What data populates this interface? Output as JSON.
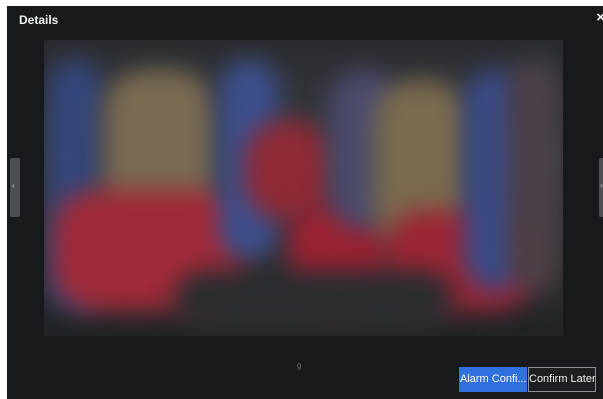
{
  "dialog": {
    "title": "Details",
    "close_glyph": "×",
    "close_icon": "close-icon"
  },
  "viewer": {
    "caption": "g",
    "prev_glyph": "‹",
    "next_glyph": "›",
    "prev_icon": "chevron-left-icon",
    "next_icon": "chevron-right-icon"
  },
  "actions": {
    "confirm_label": "Alarm Confi...",
    "later_label": "Confirm Later"
  },
  "colors": {
    "dialog_bg": "#17191c",
    "primary": "#2f6fde"
  }
}
